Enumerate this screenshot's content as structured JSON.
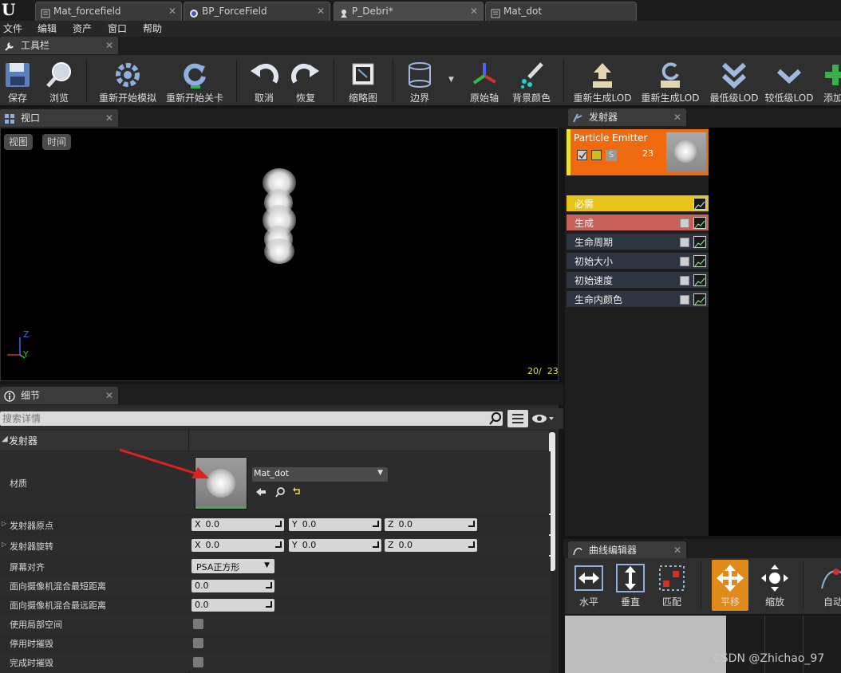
{
  "doc_tabs": [
    "Mat_forcefield",
    "BP_ForceField",
    "P_Debri*",
    "Mat_dot"
  ],
  "menu": [
    "文件",
    "编辑",
    "资产",
    "窗口",
    "帮助"
  ],
  "panels": {
    "toolbar": "工具栏",
    "viewport": "视口",
    "details": "细节",
    "emitters": "发射器",
    "curve_editor": "曲线编辑器"
  },
  "toolbar": {
    "buttons": [
      "保存",
      "浏览",
      "重新开始模拟",
      "重新开始关卡",
      "取消",
      "恢复",
      "缩略图",
      "边界",
      "原始轴",
      "背景颜色",
      "重新生成LOD",
      "重新生成LOD",
      "最低级LOD",
      "较低级LOD",
      "添加"
    ]
  },
  "viewport": {
    "buttons": [
      "视图",
      "时间"
    ],
    "counter": "20/  23",
    "axis_z": "Z",
    "axis_y": "Y"
  },
  "details": {
    "search_placeholder": "搜索详情",
    "section": "发射器",
    "material_label": "材质",
    "material_value": "Mat_dot",
    "rows": {
      "origin": "发射器原点",
      "rotation": "发射器旋转",
      "screen_align": "屏幕对齐",
      "screen_align_value": "PSA正方形",
      "min_blend": "面向摄像机混合最短距离",
      "min_blend_value": "0.0",
      "max_blend": "面向摄像机混合最远距离",
      "max_blend_value": "0.0",
      "local_space": "使用局部空间",
      "kill_on_deactivate": "停用时摧毁",
      "kill_on_complete": "完成时摧毁"
    },
    "axes": {
      "x": "X",
      "y": "Y",
      "z": "Z",
      "value": "0.0"
    }
  },
  "emitter": {
    "name": "Particle Emitter",
    "count": "23",
    "s_badge": "S",
    "modules": [
      "必需",
      "生成",
      "生命周期",
      "初始大小",
      "初始速度",
      "生命内颜色"
    ]
  },
  "curve_editor": {
    "buttons": [
      "水平",
      "垂直",
      "匹配",
      "平移",
      "缩放",
      "自动"
    ]
  },
  "watermark": "CSDN @Zhichao_97",
  "colors": {
    "emitter_header": "#f06a10",
    "required_row": "#e8c41a",
    "spawn_row": "#c8605c",
    "module_row": "#2e3540",
    "active_tool": "#e08a1c"
  }
}
